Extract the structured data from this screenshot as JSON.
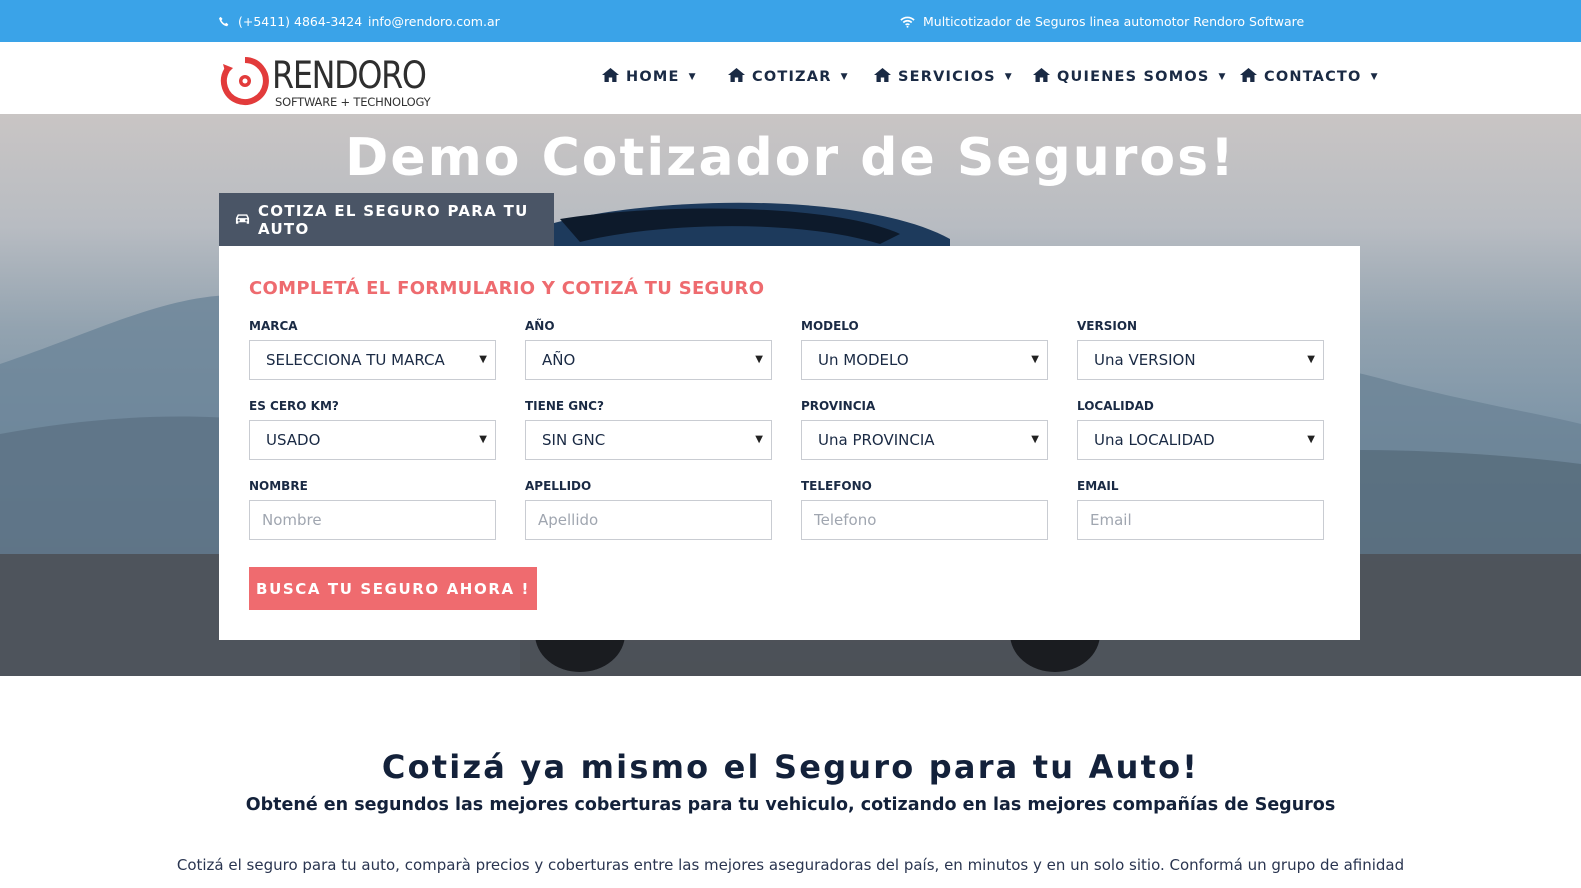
{
  "topbar": {
    "phone": "(+5411) 4864-3424",
    "email": "info@rendoro.com.ar",
    "tagline": "Multicotizador de Seguros linea automotor Rendoro Software",
    "color": "#3aa3e8"
  },
  "logo": {
    "wordmark": "RENDORO",
    "subtitle": "SOFTWARE + TECHNOLOGY"
  },
  "nav": {
    "items": [
      {
        "label": "HOME",
        "icon": "home-icon"
      },
      {
        "label": "COTIZAR",
        "icon": "home-icon"
      },
      {
        "label": "SERVICIOS",
        "icon": "home-icon"
      },
      {
        "label": "QUIENES SOMOS",
        "icon": "home-icon"
      },
      {
        "label": "CONTACTO",
        "icon": "home-icon"
      }
    ]
  },
  "hero": {
    "title": "Demo Cotizador de Seguros!",
    "tab_label": "COTIZA EL SEGURO PARA TU AUTO",
    "tab_icon": "car-icon"
  },
  "form": {
    "title": "COMPLETÁ EL FORMULARIO Y COTIZÁ TU SEGURO",
    "accent": "#ef6b6f",
    "fields": [
      {
        "label": "MARCA",
        "value": "SELECCIONA TU MARCA"
      },
      {
        "label": "AÑO",
        "value": "AÑO"
      },
      {
        "label": "MODELO",
        "value": "Un MODELO"
      },
      {
        "label": "VERSION",
        "value": "Una VERSION"
      },
      {
        "label": "ES CERO KM?",
        "value": "USADO"
      },
      {
        "label": "TIENE GNC?",
        "value": "SIN GNC"
      },
      {
        "label": "PROVINCIA",
        "value": "Una PROVINCIA"
      },
      {
        "label": "LOCALIDAD",
        "value": "Una LOCALIDAD"
      },
      {
        "label": "NOMBRE",
        "placeholder": "Nombre"
      },
      {
        "label": "APELLIDO",
        "placeholder": "Apellido"
      },
      {
        "label": "TELEFONO",
        "placeholder": "Telefono"
      },
      {
        "label": "EMAIL",
        "placeholder": "Email"
      }
    ],
    "submit_label": "BUSCA TU SEGURO AHORA !"
  },
  "intro": {
    "heading": "Cotizá ya mismo el Seguro para tu Auto!",
    "subheading": "Obtené en segundos las mejores coberturas para tu vehiculo, cotizando en las mejores compañías de Seguros",
    "paragraph": "Cotizá el seguro para tu auto, comparà precios y coberturas entre las mejores aseguradoras del país, en minutos y en un solo sitio. Conformá un grupo de afinidad"
  }
}
